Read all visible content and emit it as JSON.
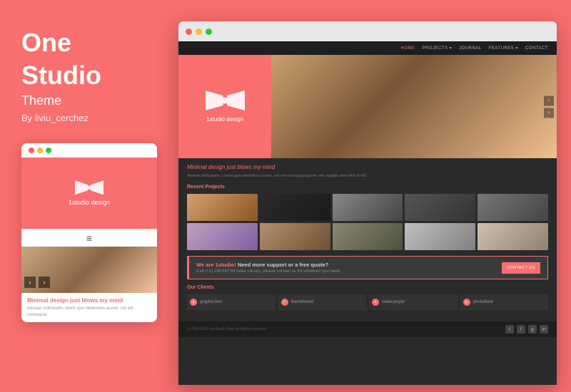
{
  "left": {
    "title_line1": "One",
    "title_line2": "Studio",
    "subtitle": "Theme",
    "author": "By liviu_cerchez",
    "mobile": {
      "brand": "1studio design",
      "hero_tagline": "Minimal design",
      "hero_tagline_accent": "just blows my mind",
      "body_text": "Aenean sollicitudin, lorem quis bibendum auctor, nisi elit consequat"
    }
  },
  "browser": {
    "nav": {
      "items": [
        "HOME",
        "PROJECTS ▾",
        "JOURNAL",
        "FEATURES ▾",
        "CONTACT"
      ]
    },
    "hero": {
      "brand": "1studio design"
    },
    "main": {
      "tagline": "Minimal design",
      "tagline_accent": "just blows my mind",
      "desc": "Aenean sollicitudin, Lorem quis bibendum auctor, nisi elit consequat ipsum, nec sagittis sem nibh id elit.",
      "projects_title": "Recent Projects",
      "cta_headline": "We are 1studio!",
      "cta_need": "Need more support or a free quote?",
      "cta_phone": "Call (+1) 234 567 89 tellus carods, please contact us for whatever you need.",
      "cta_button": "CONTACT US",
      "clients_title": "Our Clients",
      "clients": [
        {
          "icon": "g",
          "name": "graphicriver"
        },
        {
          "icon": "t",
          "name": "themeforest"
        },
        {
          "icon": "c",
          "name": "codecanyon"
        },
        {
          "icon": "p",
          "name": "photodune"
        }
      ]
    },
    "footer": {
      "copy": "© 2010-2012 OneStudio Sass All Rights Reserved",
      "social": [
        "f",
        "t",
        "g",
        "in"
      ]
    }
  },
  "colors": {
    "accent": "#f96e6e",
    "dark_bg": "#2a2a2a",
    "nav_bg": "#1e1e1e",
    "panel_bg": "#f96e6e"
  }
}
